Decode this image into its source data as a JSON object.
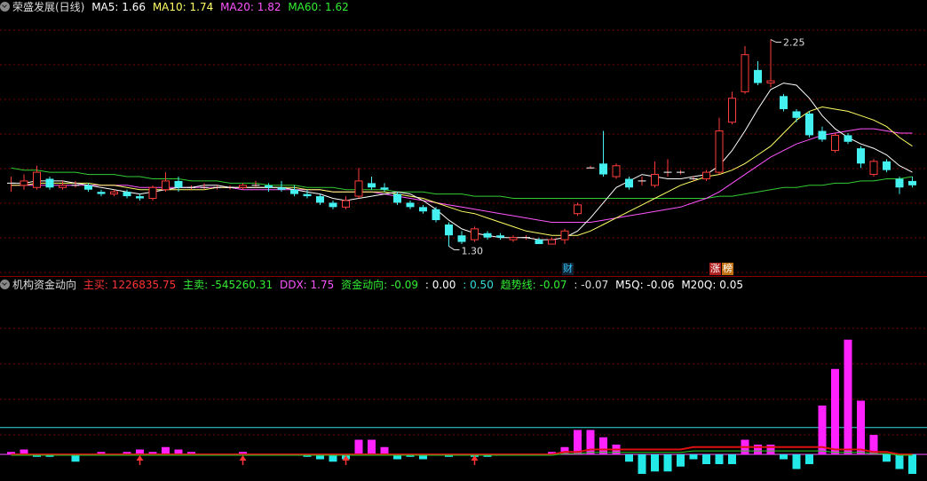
{
  "main_header": {
    "title": "荣盛发展(日线)",
    "items": [
      {
        "text": "MA5: 1.66",
        "color": "#ffffff"
      },
      {
        "text": "MA10: 1.74",
        "color": "#ffff66"
      },
      {
        "text": "MA20: 1.82",
        "color": "#ff55ff"
      },
      {
        "text": "MA60: 1.62",
        "color": "#33ee33"
      }
    ]
  },
  "sub_header": {
    "title": "机构资金动向",
    "items": [
      {
        "text": "主买: 1226835.75",
        "color": "#ff3333"
      },
      {
        "text": "主卖: -545260.31",
        "color": "#33ee33"
      },
      {
        "text": "DDX: 1.75",
        "color": "#ff55ff"
      },
      {
        "text": "资金动向: -0.09",
        "color": "#33ee33"
      },
      {
        "text": ": 0.00",
        "color": "#ffffff"
      },
      {
        "text": ": 0.50",
        "color": "#33dddd"
      },
      {
        "text": "趋势线: -0.07",
        "color": "#33ee33"
      },
      {
        "text": ": -0.07",
        "color": "#dddddd"
      },
      {
        "text": "M5Q: -0.06",
        "color": "#ffffff"
      },
      {
        "text": "M20Q: 0.05",
        "color": "#ffffff"
      }
    ]
  },
  "annotations": {
    "high_label": "2.25",
    "low_label": "1.30",
    "badge_cai": "财",
    "badge_zhang": "涨",
    "badge_bang": "榜"
  },
  "colors": {
    "up": "#ff3b3b",
    "down": "#44f0f0",
    "ma5": "#ffffff",
    "ma10": "#ffff66",
    "ma20": "#ff55ff",
    "ma60": "#33cc33",
    "grid": "#7a0000",
    "cyan_line": "#33dddd"
  },
  "chart_data": [
    {
      "type": "candlestick",
      "title": "荣盛发展(日线)",
      "ylim": [
        1.2,
        2.35
      ],
      "candles": [
        [
          1.59,
          1.59,
          1.62,
          1.55
        ],
        [
          1.58,
          1.6,
          1.63,
          1.56
        ],
        [
          1.57,
          1.64,
          1.67,
          1.56
        ],
        [
          1.61,
          1.57,
          1.62,
          1.56
        ],
        [
          1.57,
          1.58,
          1.6,
          1.56
        ],
        [
          1.58,
          1.58,
          1.6,
          1.57
        ],
        [
          1.58,
          1.56,
          1.59,
          1.55
        ],
        [
          1.55,
          1.54,
          1.56,
          1.53
        ],
        [
          1.54,
          1.55,
          1.56,
          1.53
        ],
        [
          1.55,
          1.53,
          1.56,
          1.52
        ],
        [
          1.53,
          1.52,
          1.54,
          1.51
        ],
        [
          1.52,
          1.57,
          1.58,
          1.51
        ],
        [
          1.56,
          1.6,
          1.64,
          1.55
        ],
        [
          1.6,
          1.57,
          1.62,
          1.55
        ],
        [
          1.57,
          1.57,
          1.58,
          1.56
        ],
        [
          1.57,
          1.57,
          1.59,
          1.56
        ],
        [
          1.57,
          1.57,
          1.58,
          1.56
        ],
        [
          1.57,
          1.57,
          1.58,
          1.56
        ],
        [
          1.57,
          1.58,
          1.59,
          1.56
        ],
        [
          1.58,
          1.58,
          1.6,
          1.57
        ],
        [
          1.58,
          1.57,
          1.59,
          1.55
        ],
        [
          1.57,
          1.56,
          1.6,
          1.55
        ],
        [
          1.56,
          1.54,
          1.58,
          1.53
        ],
        [
          1.54,
          1.53,
          1.56,
          1.52
        ],
        [
          1.53,
          1.5,
          1.54,
          1.49
        ],
        [
          1.5,
          1.48,
          1.51,
          1.47
        ],
        [
          1.48,
          1.51,
          1.53,
          1.47
        ],
        [
          1.53,
          1.6,
          1.66,
          1.52
        ],
        [
          1.59,
          1.57,
          1.62,
          1.56
        ],
        [
          1.57,
          1.56,
          1.59,
          1.55
        ],
        [
          1.54,
          1.5,
          1.55,
          1.49
        ],
        [
          1.5,
          1.48,
          1.51,
          1.47
        ],
        [
          1.48,
          1.46,
          1.49,
          1.45
        ],
        [
          1.47,
          1.42,
          1.48,
          1.41
        ],
        [
          1.4,
          1.35,
          1.41,
          1.3
        ],
        [
          1.35,
          1.32,
          1.37,
          1.31
        ],
        [
          1.33,
          1.38,
          1.39,
          1.32
        ],
        [
          1.36,
          1.34,
          1.37,
          1.33
        ],
        [
          1.35,
          1.34,
          1.36,
          1.33
        ],
        [
          1.33,
          1.34,
          1.35,
          1.32
        ],
        [
          1.34,
          1.34,
          1.35,
          1.33
        ],
        [
          1.33,
          1.31,
          1.34,
          1.31
        ],
        [
          1.31,
          1.33,
          1.34,
          1.31
        ],
        [
          1.33,
          1.37,
          1.38,
          1.31
        ],
        [
          1.45,
          1.49,
          1.5,
          1.44
        ],
        [
          1.66,
          1.66,
          1.67,
          1.66
        ],
        [
          1.68,
          1.63,
          1.83,
          1.62
        ],
        [
          1.62,
          1.67,
          1.68,
          1.61
        ],
        [
          1.61,
          1.57,
          1.62,
          1.56
        ],
        [
          1.6,
          1.6,
          1.62,
          1.58
        ],
        [
          1.58,
          1.63,
          1.69,
          1.57
        ],
        [
          1.64,
          1.64,
          1.7,
          1.62
        ],
        [
          1.64,
          1.64,
          1.65,
          1.63
        ],
        [
          1.61,
          1.61,
          1.62,
          1.6
        ],
        [
          1.61,
          1.64,
          1.65,
          1.6
        ],
        [
          1.64,
          1.83,
          1.89,
          1.63
        ],
        [
          1.87,
          1.98,
          2.01,
          1.86
        ],
        [
          2.01,
          2.18,
          2.22,
          2.0
        ],
        [
          2.11,
          2.05,
          2.15,
          2.04
        ],
        [
          2.05,
          2.06,
          2.25,
          2.03
        ],
        [
          1.99,
          1.93,
          2.0,
          1.92
        ],
        [
          1.92,
          1.89,
          1.93,
          1.87
        ],
        [
          1.91,
          1.81,
          1.92,
          1.8
        ],
        [
          1.83,
          1.79,
          1.85,
          1.78
        ],
        [
          1.74,
          1.81,
          1.82,
          1.73
        ],
        [
          1.81,
          1.78,
          1.82,
          1.77
        ],
        [
          1.75,
          1.68,
          1.76,
          1.66
        ],
        [
          1.63,
          1.69,
          1.7,
          1.62
        ],
        [
          1.69,
          1.65,
          1.7,
          1.64
        ],
        [
          1.61,
          1.57,
          1.62,
          1.54
        ],
        [
          1.6,
          1.58,
          1.62,
          1.57
        ]
      ],
      "ma5": [
        1.59,
        1.59,
        1.6,
        1.6,
        1.6,
        1.59,
        1.58,
        1.57,
        1.56,
        1.55,
        1.54,
        1.55,
        1.56,
        1.57,
        1.57,
        1.58,
        1.58,
        1.57,
        1.57,
        1.57,
        1.57,
        1.57,
        1.56,
        1.55,
        1.54,
        1.52,
        1.51,
        1.52,
        1.53,
        1.54,
        1.55,
        1.54,
        1.51,
        1.47,
        1.42,
        1.38,
        1.36,
        1.35,
        1.34,
        1.34,
        1.34,
        1.33,
        1.33,
        1.34,
        1.37,
        1.43,
        1.5,
        1.57,
        1.6,
        1.63,
        1.62,
        1.61,
        1.61,
        1.62,
        1.63,
        1.67,
        1.74,
        1.83,
        1.93,
        2.02,
        2.05,
        2.04,
        1.98,
        1.9,
        1.84,
        1.8,
        1.77,
        1.75,
        1.72,
        1.67,
        1.64
      ],
      "ma10": [
        1.58,
        1.58,
        1.59,
        1.59,
        1.59,
        1.59,
        1.59,
        1.58,
        1.58,
        1.57,
        1.56,
        1.56,
        1.56,
        1.56,
        1.56,
        1.56,
        1.57,
        1.57,
        1.57,
        1.57,
        1.57,
        1.57,
        1.57,
        1.56,
        1.56,
        1.55,
        1.55,
        1.55,
        1.55,
        1.55,
        1.54,
        1.53,
        1.52,
        1.5,
        1.48,
        1.46,
        1.45,
        1.43,
        1.41,
        1.39,
        1.37,
        1.36,
        1.35,
        1.35,
        1.35,
        1.37,
        1.4,
        1.43,
        1.46,
        1.49,
        1.52,
        1.55,
        1.58,
        1.6,
        1.62,
        1.63,
        1.65,
        1.68,
        1.72,
        1.76,
        1.82,
        1.88,
        1.92,
        1.94,
        1.93,
        1.92,
        1.9,
        1.88,
        1.85,
        1.8,
        1.76
      ],
      "ma20": [
        1.58,
        1.58,
        1.58,
        1.58,
        1.58,
        1.58,
        1.58,
        1.58,
        1.58,
        1.58,
        1.57,
        1.57,
        1.57,
        1.57,
        1.57,
        1.57,
        1.57,
        1.57,
        1.56,
        1.56,
        1.56,
        1.56,
        1.56,
        1.56,
        1.56,
        1.55,
        1.55,
        1.55,
        1.55,
        1.54,
        1.53,
        1.52,
        1.51,
        1.5,
        1.49,
        1.48,
        1.47,
        1.46,
        1.45,
        1.44,
        1.43,
        1.42,
        1.41,
        1.41,
        1.41,
        1.41,
        1.42,
        1.43,
        1.44,
        1.45,
        1.46,
        1.47,
        1.48,
        1.5,
        1.52,
        1.55,
        1.59,
        1.63,
        1.67,
        1.71,
        1.74,
        1.77,
        1.79,
        1.81,
        1.82,
        1.83,
        1.84,
        1.84,
        1.83,
        1.82,
        1.82
      ],
      "ma60": [
        1.66,
        1.65,
        1.65,
        1.64,
        1.64,
        1.64,
        1.63,
        1.63,
        1.63,
        1.62,
        1.62,
        1.61,
        1.61,
        1.61,
        1.6,
        1.6,
        1.6,
        1.59,
        1.59,
        1.59,
        1.58,
        1.58,
        1.58,
        1.57,
        1.57,
        1.57,
        1.56,
        1.56,
        1.56,
        1.56,
        1.55,
        1.55,
        1.55,
        1.54,
        1.54,
        1.54,
        1.53,
        1.53,
        1.53,
        1.52,
        1.52,
        1.52,
        1.52,
        1.52,
        1.52,
        1.52,
        1.52,
        1.52,
        1.52,
        1.52,
        1.52,
        1.52,
        1.52,
        1.52,
        1.52,
        1.53,
        1.53,
        1.54,
        1.55,
        1.56,
        1.57,
        1.57,
        1.58,
        1.58,
        1.59,
        1.59,
        1.6,
        1.6,
        1.61,
        1.61,
        1.62
      ]
    },
    {
      "type": "bar",
      "title": "机构资金动向",
      "ylim": [
        -10,
        70
      ],
      "level_line": 11,
      "values": [
        1,
        2,
        -1,
        -1,
        0,
        -3,
        0,
        1,
        0,
        1,
        2,
        1,
        3,
        2,
        1,
        0,
        0,
        0,
        1,
        0,
        0,
        0,
        0,
        -1,
        -2,
        -3,
        -2,
        6,
        6,
        3,
        -2,
        -1,
        -2,
        0,
        -1,
        0,
        -1,
        -1,
        0,
        0,
        0,
        0,
        1,
        3,
        10,
        10,
        7,
        4,
        -3,
        -8,
        -7,
        -7,
        -5,
        -2,
        -4,
        -4,
        -4,
        6,
        4,
        4,
        -2,
        -6,
        -4,
        20,
        35,
        47,
        22,
        8,
        -3,
        -6,
        -8
      ],
      "arrows": [
        10,
        18,
        26,
        36
      ],
      "trend": [
        0,
        0,
        0,
        0,
        0,
        0,
        0,
        0,
        0,
        0,
        0,
        0,
        0,
        0,
        0,
        0,
        0,
        0,
        0,
        0,
        0,
        0,
        0,
        0,
        0,
        0,
        0,
        0,
        0,
        0,
        0,
        0,
        0,
        0,
        0,
        0,
        0,
        0,
        0,
        0,
        0,
        0,
        0,
        1,
        1,
        2,
        2,
        2,
        2,
        2,
        2,
        2,
        2,
        3,
        3,
        3,
        3,
        3,
        3,
        3,
        3,
        3,
        3,
        3,
        2,
        2,
        2,
        1,
        1,
        0,
        0
      ]
    }
  ]
}
